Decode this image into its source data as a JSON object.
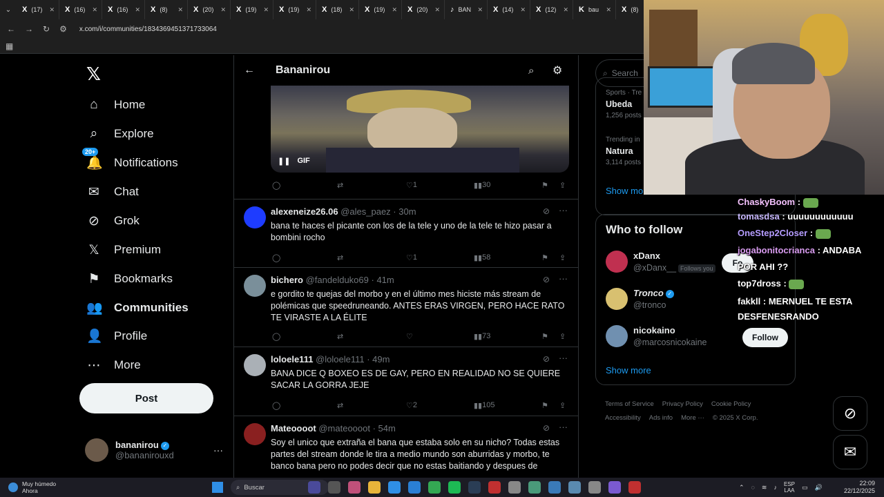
{
  "browser": {
    "tabs": [
      {
        "icon": "X",
        "label": "(17)"
      },
      {
        "icon": "X",
        "label": "(16)"
      },
      {
        "icon": "X",
        "label": "(16)"
      },
      {
        "icon": "X",
        "label": "(8)"
      },
      {
        "icon": "X",
        "label": "(20)"
      },
      {
        "icon": "X",
        "label": "(19)"
      },
      {
        "icon": "X",
        "label": "(19)"
      },
      {
        "icon": "X",
        "label": "(18)"
      },
      {
        "icon": "X",
        "label": "(19)"
      },
      {
        "icon": "X",
        "label": "(20)"
      },
      {
        "icon": "♪",
        "label": "BAN"
      },
      {
        "icon": "X",
        "label": "(14)"
      },
      {
        "icon": "X",
        "label": "(12)"
      },
      {
        "icon": "K",
        "label": "bau"
      },
      {
        "icon": "X",
        "label": "(8)"
      }
    ],
    "url": "x.com/i/communities/1834369451371733064"
  },
  "nav": {
    "logo": "𝕏",
    "items": [
      {
        "label": "Home",
        "icon": "⌂"
      },
      {
        "label": "Explore",
        "icon": "⌕"
      },
      {
        "label": "Notifications",
        "icon": "🔔",
        "badge": "20+"
      },
      {
        "label": "Chat",
        "icon": "✉"
      },
      {
        "label": "Grok",
        "icon": "⊘"
      },
      {
        "label": "Premium",
        "icon": "𝕏"
      },
      {
        "label": "Bookmarks",
        "icon": "⚑"
      },
      {
        "label": "Communities",
        "icon": "👥"
      },
      {
        "label": "Profile",
        "icon": "👤"
      },
      {
        "label": "More",
        "icon": "⋯"
      }
    ],
    "post_label": "Post",
    "account": {
      "name": "bananirou",
      "handle": "@bananirouxd",
      "more": "···"
    }
  },
  "community": {
    "title": "Bananirou",
    "gif_label": "GIF",
    "first_post_stats": {
      "likes": "1",
      "views": "30"
    }
  },
  "tweets": [
    {
      "name": "alexeneize26.06",
      "handle": "@ales_paez",
      "time": "· 30m",
      "text": "bana te haces el picante con los de la tele y uno de la tele te hizo pasar a bombini rocho",
      "replies": "",
      "retweets": "",
      "likes": "1",
      "views": "58",
      "avatar_color": "#1e3cff"
    },
    {
      "name": "bichero",
      "handle": "@fandelduko69",
      "time": "· 41m",
      "text": "e gordito te quejas del morbo y en el último mes hiciste más stream de polémicas que speedruneando. ANTES ERAS VIRGEN, PERO HACE RATO TE VIRASTE A LA ÉLITE",
      "replies": "",
      "retweets": "",
      "likes": "",
      "views": "73",
      "avatar_color": "#7a8f9a"
    },
    {
      "name": "loloele111",
      "handle": "@loloele111",
      "time": "· 49m",
      "text": "BANA DICE Q BOXEO ES DE GAY, PERO EN REALIDAD NO SE QUIERE SACAR LA GORRA JEJE",
      "replies": "",
      "retweets": "",
      "likes": "2",
      "views": "105",
      "avatar_color": "#aab0b6"
    },
    {
      "name": "Mateoooot",
      "handle": "@mateoooot",
      "time": "· 54m",
      "text": "Soy el unico que extraña el bana que estaba solo en su nicho? Todas estas partes del stream donde le tira a medio mundo son aburridas y morbo, te banco bana pero no podes decir que no estas baitiando y despues de",
      "replies": "",
      "retweets": "",
      "likes": "",
      "views": "",
      "avatar_color": "#8a2020"
    }
  ],
  "right": {
    "search_placeholder": "Search",
    "trends": [
      {
        "category": "Sports · Tre",
        "name": "Ubeda",
        "posts": "1,256 posts"
      },
      {
        "category": "Trending in",
        "name": "Natura",
        "posts": "3,114 posts"
      }
    ],
    "trends_show_more": "Show mo",
    "who_to_follow": "Who to follow",
    "follow": [
      {
        "name": "xDanx",
        "handle": "@xDanx__",
        "follows_you": "Follows you",
        "button": "Fo",
        "avatar_color": "#c03050"
      },
      {
        "name": "Tronco",
        "handle": "@tronco",
        "follows_you": "",
        "button": "",
        "avatar_color": "#d8c070"
      },
      {
        "name": "nicokaino",
        "handle": "@marcosnicokaine",
        "follows_you": "",
        "button": "Follow",
        "avatar_color": "#7090b0"
      }
    ],
    "show_more": "Show more",
    "footer": [
      "Terms of Service",
      "Privacy Policy",
      "Cookie Policy",
      "Accessibility",
      "Ads info",
      "More ···",
      "© 2025 X Corp."
    ]
  },
  "chat": [
    {
      "user": "ChaskyBoom",
      "msg": "",
      "color": "#f5c2ff"
    },
    {
      "user": "tomasdsa",
      "msg": "uuuuuuuuuuuu",
      "color": "#c9b9ff"
    },
    {
      "user": "OneStep2Closer",
      "msg": "",
      "color": "#b59cff"
    },
    {
      "user": "jogabonitocrianca",
      "msg": "ANDABA",
      "color": "#d99cf0"
    },
    {
      "user": "",
      "msg": "POR AHI ??",
      "color": "#ffffff"
    },
    {
      "user": "top7dross",
      "msg": "",
      "color": "#ffffff"
    },
    {
      "user": "fakkll",
      "msg": "MERNUEL TE ESTA",
      "color": "#ffffff"
    },
    {
      "user": "",
      "msg": "DESFENESRANDO",
      "color": "#ffffff"
    }
  ],
  "taskbar": {
    "weather_title": "Muy húmedo",
    "weather_sub": "Ahora",
    "search_label": "Buscar",
    "lang_top": "ESP",
    "lang_bottom": "LAA",
    "time": "22:09",
    "date": "22/12/2025"
  }
}
